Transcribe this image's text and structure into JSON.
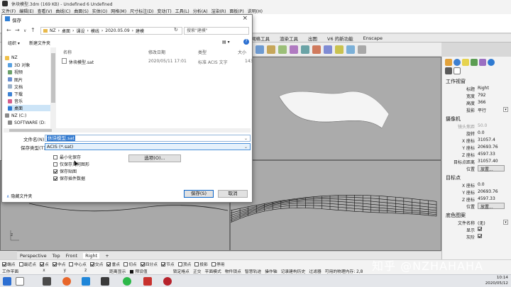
{
  "app": {
    "title": "休块模型.3dm (169 KB) - Undefined 6 Undefined",
    "menu": [
      "文件(F)",
      "编辑(E)",
      "查看(V)",
      "曲线(C)",
      "曲面(S)",
      "实体(O)",
      "网格(M)",
      "尺寸标注(D)",
      "变动(T)",
      "工具(L)",
      "分析(A)",
      "渲染(R)",
      "面板(P)",
      "说明(H)"
    ]
  },
  "toolbar_tabs": [
    "网格工具",
    "渲染工具",
    "出图",
    "V6 的新功能",
    "Enscape"
  ],
  "viewport_tabs": [
    "Perspective",
    "Top",
    "Front",
    "Right",
    "+"
  ],
  "active_viewport": "Right",
  "osnaps": [
    {
      "label": "端点",
      "on": true
    },
    {
      "label": "最近点",
      "on": false
    },
    {
      "label": "点",
      "on": true
    },
    {
      "label": "中点",
      "on": true
    },
    {
      "label": "中心点",
      "on": false
    },
    {
      "label": "交点",
      "on": true
    },
    {
      "label": "垂点",
      "on": true
    },
    {
      "label": "切点",
      "on": false
    },
    {
      "label": "四分点",
      "on": true
    },
    {
      "label": "节点",
      "on": true
    },
    {
      "label": "顶点",
      "on": false
    },
    {
      "label": "投影",
      "on": false
    },
    {
      "label": "停用",
      "on": false
    }
  ],
  "status": {
    "plane": "工作平面",
    "x": "x",
    "y": "y",
    "z": "z",
    "units": "距离显示",
    "layer": "预设值",
    "toggles": [
      "锁定格点",
      "正交",
      "平面模式",
      "物件锁点",
      "智慧轨迹",
      "操作轴",
      "记录建构历史",
      "过滤器",
      "可用的物理内存: 2,8"
    ]
  },
  "tray": {
    "time": "10:14",
    "date": "2020/05/12"
  },
  "watermark": "知乎 @NZHAHAHA",
  "panel": {
    "sections": {
      "view": "工作视窗",
      "camera": "摄像机",
      "target": "目标点",
      "background": "底色图案"
    },
    "view_rows": [
      {
        "k": "标题",
        "v": "Right"
      },
      {
        "k": "宽度",
        "v": "792"
      },
      {
        "k": "高度",
        "v": "366"
      },
      {
        "k": "投影",
        "v": "平行"
      }
    ],
    "camera_rows": [
      {
        "k": "镜头焦距",
        "v": "50.0",
        "dim": true
      },
      {
        "k": "旋转",
        "v": "0.0"
      },
      {
        "k": "X 座标",
        "v": "31057.4"
      },
      {
        "k": "Y 座标",
        "v": "20693.76"
      },
      {
        "k": "Z 座标",
        "v": "4597.33"
      },
      {
        "k": "目标点距离",
        "v": "31057.40"
      },
      {
        "k": "位置",
        "btn": "放置..."
      }
    ],
    "target_rows": [
      {
        "k": "X 座标",
        "v": "0.0"
      },
      {
        "k": "Y 座标",
        "v": "20693.76"
      },
      {
        "k": "Z 座标",
        "v": "4597.33"
      },
      {
        "k": "位置",
        "btn": "放置..."
      }
    ],
    "bg_rows": [
      {
        "k": "文件名称",
        "v": "(无)"
      },
      {
        "k": "显示",
        "chk": true
      },
      {
        "k": "灰阶",
        "chk": true
      }
    ]
  },
  "dialog": {
    "title": "保存",
    "path": [
      "NZ",
      "桌面",
      "课设",
      "模线",
      "2020.05.09",
      "建模"
    ],
    "search_placeholder": "搜索\"建模\"",
    "organize": "组织 ▾",
    "new_folder": "新建文件夹",
    "nav": [
      "NZ",
      "3D 对象",
      "视频",
      "图片",
      "文档",
      "下载",
      "音乐",
      "桌面",
      "NZ (C:)",
      "SOFTWARE (D:"
    ],
    "nav_selected": "桌面",
    "columns": {
      "name": "名称",
      "date": "修改日期",
      "type": "类型",
      "size": "大小"
    },
    "files": [
      {
        "name": "休块模型.sat",
        "date": "2020/05/11 17:01",
        "type": "标准 ACIS 文字",
        "size": "143"
      }
    ],
    "filename_label": "文件名(N):",
    "filename": "休块模型.sat",
    "filetype_label": "保存类型(T):",
    "filetype": "ACIS (*.sat)",
    "options": [
      {
        "label": "最小化保存",
        "on": false
      },
      {
        "label": "仅保存几何图形",
        "on": false
      },
      {
        "label": "保存贴图",
        "on": true
      },
      {
        "label": "保存插件数据",
        "on": true
      }
    ],
    "options_button": "选项(O)...",
    "save_button": "保存(S)",
    "cancel_button": "取消",
    "hide_folders": "隐藏文件夹"
  }
}
